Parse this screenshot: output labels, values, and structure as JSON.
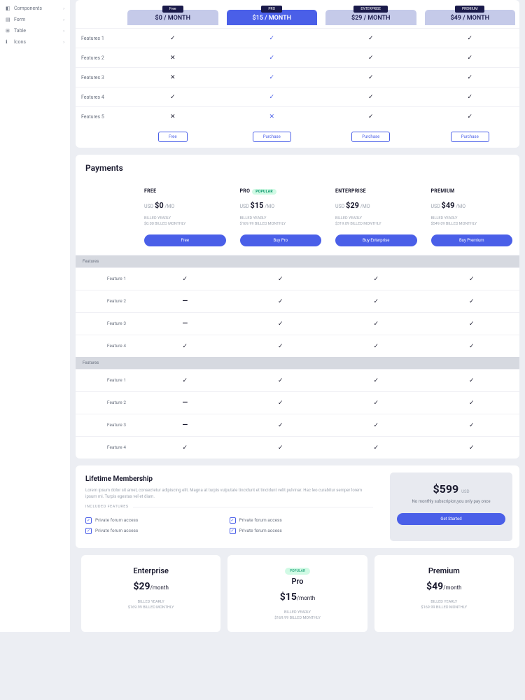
{
  "sidebar": {
    "items": [
      {
        "label": "Components"
      },
      {
        "label": "Form"
      },
      {
        "label": "Table"
      },
      {
        "label": "Icons"
      }
    ]
  },
  "comparison": {
    "plans": [
      {
        "tag": "Free",
        "price": "$0 / MONTH",
        "accent": false,
        "action": "Free"
      },
      {
        "tag": "PRO",
        "price": "$15 / MONTH",
        "accent": true,
        "action": "Purchase"
      },
      {
        "tag": "ENTERPRISE",
        "price": "$29 / MONTH",
        "accent": false,
        "action": "Purchase"
      },
      {
        "tag": "PREMIUM",
        "price": "$49 / MONTH",
        "accent": false,
        "action": "Purchase"
      }
    ],
    "rows": [
      {
        "name": "Features 1",
        "cells": [
          "check",
          "check-blue",
          "check",
          "check"
        ]
      },
      {
        "name": "Features 2",
        "cells": [
          "cross",
          "check-blue",
          "check",
          "check"
        ]
      },
      {
        "name": "Features 3",
        "cells": [
          "cross",
          "check-blue",
          "check",
          "check"
        ]
      },
      {
        "name": "Features 4",
        "cells": [
          "check",
          "check-blue",
          "check",
          "check"
        ]
      },
      {
        "name": "Features 5",
        "cells": [
          "cross",
          "cross-blue",
          "check",
          "check"
        ]
      }
    ]
  },
  "payments": {
    "title": "Payments",
    "features_label": "Features",
    "billed_yearly": "BILLED YEARLY",
    "plans": [
      {
        "name": "FREE",
        "popular": false,
        "usd": "USD",
        "price": "$0",
        "per": "/MO",
        "monthly": "$0.00 BILLED MONTHLY",
        "btn": "Free"
      },
      {
        "name": "PRO",
        "popular": true,
        "popular_label": "POPULAR",
        "usd": "USD",
        "price": "$15",
        "per": "/MO",
        "monthly": "$169.99 BILLED MONTHLY",
        "btn": "Buy Pro"
      },
      {
        "name": "ENTERPRISE",
        "popular": false,
        "usd": "USD",
        "price": "$29",
        "per": "/MO",
        "monthly": "$319.89 BILLED MONTHLY",
        "btn": "Buy Enterprise"
      },
      {
        "name": "PREMIUM",
        "popular": false,
        "usd": "USD",
        "price": "$49",
        "per": "/MO",
        "monthly": "$549.09 BILLED MONTHLY",
        "btn": "Buy Premium"
      }
    ],
    "rows": [
      {
        "name": "Feature 1",
        "cells": [
          "check",
          "check",
          "check",
          "check"
        ]
      },
      {
        "name": "Feature 2",
        "cells": [
          "dash",
          "check",
          "check",
          "check"
        ]
      },
      {
        "name": "Feature 3",
        "cells": [
          "dash",
          "check",
          "check",
          "check"
        ]
      },
      {
        "name": "Feature 4",
        "cells": [
          "check",
          "check",
          "check",
          "check"
        ]
      }
    ]
  },
  "lifetime": {
    "title": "Lifetime Membership",
    "desc": "Lorem ipsum dolor sit amet, consectetur adipiscing elit. Magna at turpis vulputate tincidunt et tincidunt velit pulvinar. Hac leo curabitur semper lorem ipsum mi. Turpis egestas vel et diam.",
    "included": "INCLUDED FEATURES",
    "feats": [
      "Private forum access",
      "Private forum access",
      "Private forum access",
      "Private forum access"
    ],
    "price": "$599",
    "currency": "USD",
    "note": "No monthly subscripion,you only pay once",
    "btn": "Get Started"
  },
  "bottom": {
    "popular": "POPULAR",
    "plans": [
      {
        "name": "Enterprise",
        "price": "$29",
        "per": "/month",
        "y": "BILLED YEARLY",
        "m": "$169.99 BILLED MONTHLY",
        "popular": false
      },
      {
        "name": "Pro",
        "price": "$15",
        "per": "/month",
        "y": "BILLED YEARLY",
        "m": "$169.99 BILLED MONTHLY",
        "popular": true
      },
      {
        "name": "Premium",
        "price": "$49",
        "per": "/month",
        "y": "BILLED YEARLY",
        "m": "$169.99 BILLED MONTHLY",
        "popular": false
      }
    ]
  }
}
